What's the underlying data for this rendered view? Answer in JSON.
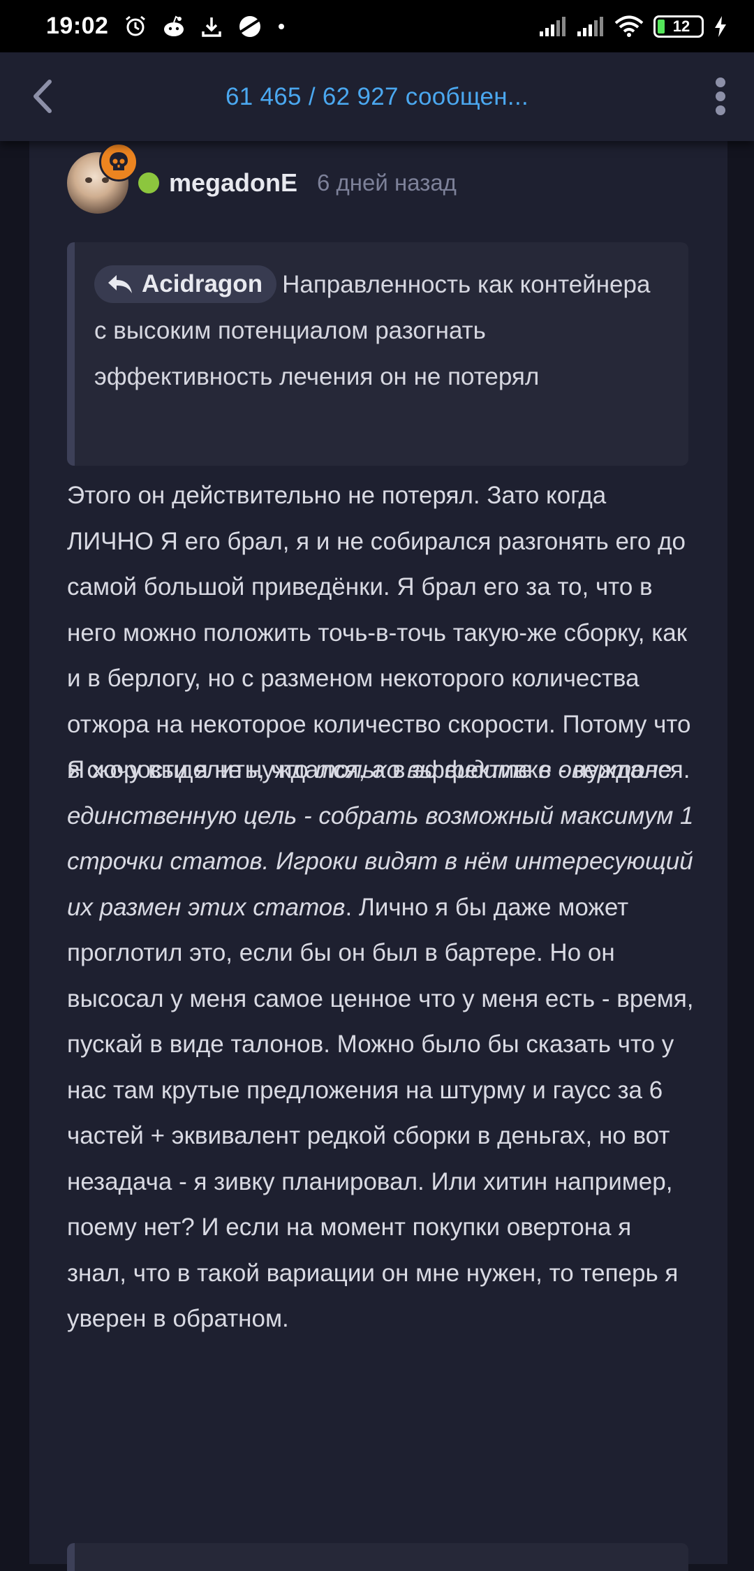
{
  "status_bar": {
    "time": "19:02",
    "battery": "12",
    "icons": [
      "alarm-icon",
      "reddit-icon",
      "download-icon",
      "planet-icon",
      "dot-icon",
      "signal-icon",
      "signal-icon",
      "wifi-icon",
      "battery-icon",
      "charging-icon"
    ]
  },
  "header": {
    "title": "61 465 / 62 927 сообщен...",
    "back_icon": "chevron-left-icon",
    "menu_icon": "more-vertical-icon"
  },
  "post": {
    "username": "megadonE",
    "time_ago": "6 дней назад",
    "badge_icon": "skull-icon",
    "online": true,
    "quote": {
      "author": "Acidragon",
      "text": "Направленность как контейнера с высоким потенциалом разогнать эффективность лечения он не потерял"
    },
    "paragraph1": "Этого он действительно не потерял. Зато когда ЛИЧНО Я его брал, я и не собирался разгонять его до самой большой приведёнки. Я брал его за то, что в него можно положить точь-в-точь такую-же сборку, как и в берлогу, но с разменом некоторого количества отжора на некоторое количество скорости. Потому что в скорости я не нуждался, а в эффективке - нуждался.",
    "paragraph2_start": "Я хочу выделить, что ",
    "paragraph2_italic": "только вы видите в овертоне единственную цель - собрать возможный максимум 1 строчки статов. Игроки видят в нём интересующий их размен этих статов",
    "paragraph2_end": ". Лично я бы даже может проглотил это, если бы он был в бартере. Но он высосал у меня самое ценное что у меня есть - время, пускай в виде талонов. Можно было бы сказать что у нас там крутые предложения на штурму и гаусс за 6 частей + эквивалент редкой сборки в деньгах, но вот незадача - я зивку планировал. Или хитин например, поему нет? И если на момент покупки овертона я знал, что в такой вариации он мне нужен, то теперь я уверен в обратном."
  },
  "colors": {
    "background": "#13141f",
    "card": "#1e2030",
    "accent": "#4ba8f0",
    "online": "#8cc63e",
    "badge": "#ec8420"
  }
}
